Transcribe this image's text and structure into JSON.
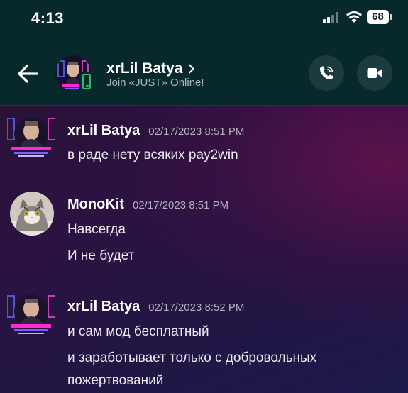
{
  "status_bar": {
    "time": "4:13",
    "battery": "68"
  },
  "header": {
    "name": "xrLil Batya",
    "subtitle": "Join «JUST» Online!",
    "icons": {
      "back": "arrow-left",
      "call": "phone",
      "video": "video-camera",
      "status": "mobile-phone-green"
    }
  },
  "messages": [
    {
      "author": "xrLil Batya",
      "timestamp": "02/17/2023 8:51 PM",
      "lines": [
        "в раде нету всяких pay2win"
      ]
    },
    {
      "author": "MonoKit",
      "timestamp": "02/17/2023 8:51 PM",
      "lines": [
        "Навсегда",
        "И не будет"
      ]
    },
    {
      "author": "xrLil Batya",
      "timestamp": "02/17/2023 8:52 PM",
      "lines": [
        "и сам мод бесплатный",
        "и заработывает только с добровольных",
        "пожертвований"
      ]
    }
  ],
  "colors": {
    "header_bg": "#07292c",
    "online_green": "#2fb969",
    "chat_bg_top": "#2a1238",
    "chat_bg_bottom": "#1d1a4b"
  }
}
